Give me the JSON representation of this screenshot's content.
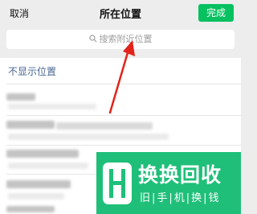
{
  "nav": {
    "cancel_label": "取消",
    "title": "所在位置",
    "done_label": "完成"
  },
  "search": {
    "placeholder": "搜索附近位置",
    "icon": "search-icon"
  },
  "list": {
    "hide_location_label": "不显示位置"
  },
  "watermark": {
    "name": "换换回收",
    "subtitle": "旧|手|机|换|钱"
  },
  "colors": {
    "accent": "#07c160",
    "link": "#4a6793",
    "arrow": "#e2231a",
    "watermark_bg": "#1fbf79"
  }
}
